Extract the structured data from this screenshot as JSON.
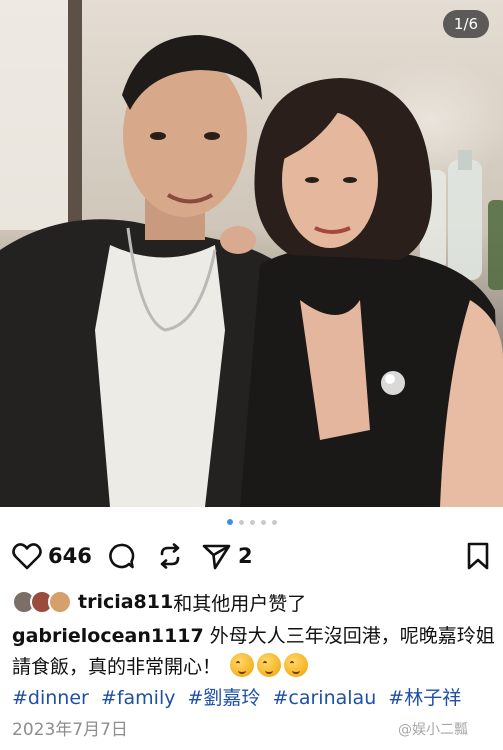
{
  "post": {
    "image_counter": "1/6",
    "carousel": {
      "count": 5,
      "active_index": 0
    }
  },
  "actions": {
    "like_count": "646",
    "share_count": "2"
  },
  "likes_line": {
    "user": "tricia811",
    "suffix": "和其他用户赞了"
  },
  "caption": {
    "author": "gabrielocean1117",
    "text": "外母大人三年沒回港，呢晚嘉玲姐請食飯，真的非常開心！",
    "emoji": "face-with-party-horn"
  },
  "hashtags": [
    "#dinner",
    "#family",
    "#劉嘉玲",
    "#carinalau",
    "#林子祥"
  ],
  "date": "2023年7月7日",
  "watermark": "@娱小二瓢",
  "colors": {
    "hashtag": "#1f4fa8",
    "carousel_active": "#3a8ff1",
    "date": "#8e8e8e"
  }
}
